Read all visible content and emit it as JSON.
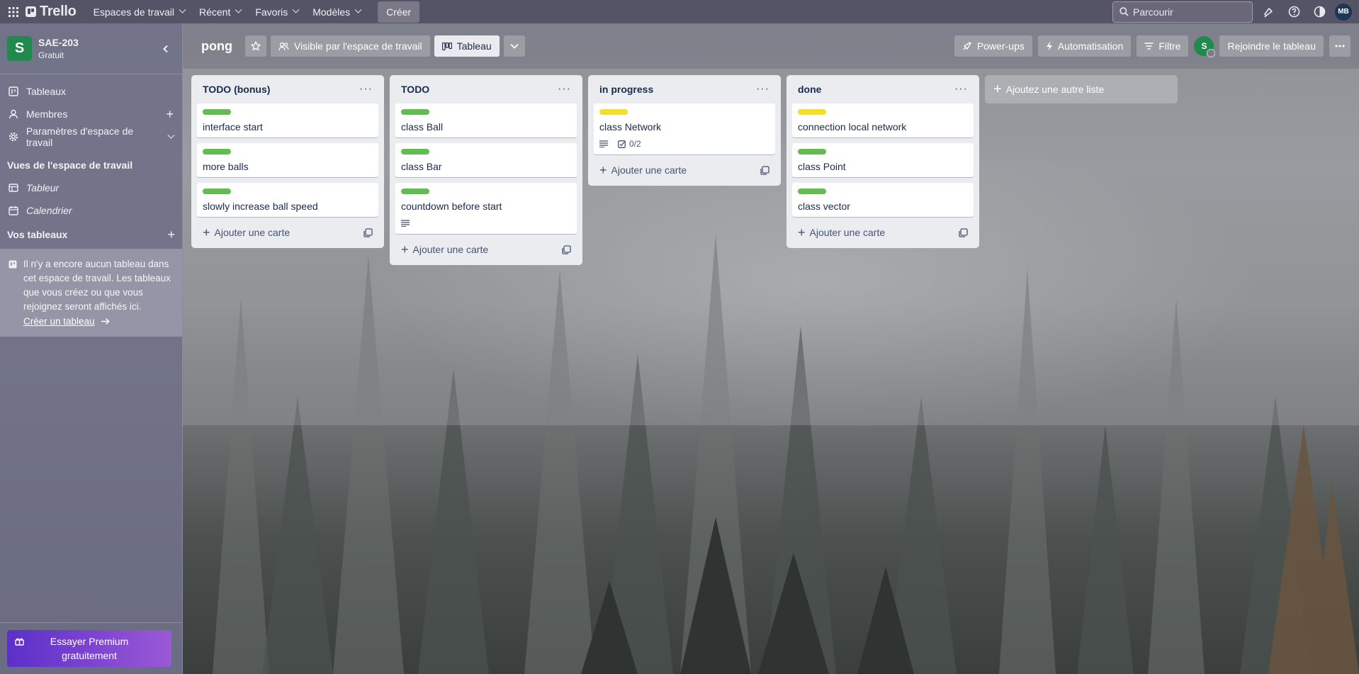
{
  "topbar": {
    "logo": "Trello",
    "nav": [
      {
        "label": "Espaces de travail"
      },
      {
        "label": "Récent"
      },
      {
        "label": "Favoris"
      },
      {
        "label": "Modèles"
      }
    ],
    "create": "Créer",
    "search_placeholder": "Parcourir",
    "user_initials": "MB"
  },
  "sidebar": {
    "workspace_initial": "S",
    "workspace_name": "SAE-203",
    "workspace_plan": "Gratuit",
    "items": [
      {
        "label": "Tableaux"
      },
      {
        "label": "Membres"
      },
      {
        "label": "Paramètres d'espace de travail"
      }
    ],
    "views_heading": "Vues de l'espace de travail",
    "views": [
      {
        "label": "Tableur"
      },
      {
        "label": "Calendrier"
      }
    ],
    "boards_heading": "Vos tableaux",
    "empty_text": "Il n'y a encore aucun tableau dans cet espace de travail. Les tableaux que vous créez ou que vous rejoignez seront affichés ici.",
    "create_board": "Créer un tableau",
    "premium": "Essayer Premium gratuitement"
  },
  "board": {
    "title": "pong",
    "visibility": "Visible par l'espace de travail",
    "view": "Tableau",
    "powerups": "Power-ups",
    "automation": "Automatisation",
    "filter": "Filtre",
    "member_initial": "S",
    "join": "Rejoindre le tableau"
  },
  "colors": {
    "green": "#61bd4f",
    "yellow": "#f5dd29"
  },
  "lists": [
    {
      "title": "TODO (bonus)",
      "add_card": "Ajouter une carte",
      "cards": [
        {
          "title": "interface start",
          "label": "green"
        },
        {
          "title": "more balls",
          "label": "green"
        },
        {
          "title": "slowly increase ball speed",
          "label": "green"
        }
      ]
    },
    {
      "title": "TODO",
      "add_card": "Ajouter une carte",
      "cards": [
        {
          "title": "class Ball",
          "label": "green"
        },
        {
          "title": "class Bar",
          "label": "green"
        },
        {
          "title": "countdown before start",
          "label": "green",
          "description": true
        }
      ]
    },
    {
      "title": "in progress",
      "add_card": "Ajouter une carte",
      "cards": [
        {
          "title": "class Network",
          "label": "yellow",
          "description": true,
          "checklist": "0/2"
        }
      ]
    },
    {
      "title": "done",
      "add_card": "Ajouter une carte",
      "cards": [
        {
          "title": "connection local network",
          "label": "yellow"
        },
        {
          "title": "class Point",
          "label": "green"
        },
        {
          "title": "class vector",
          "label": "green"
        }
      ]
    }
  ],
  "add_list": "Ajoutez une autre liste"
}
